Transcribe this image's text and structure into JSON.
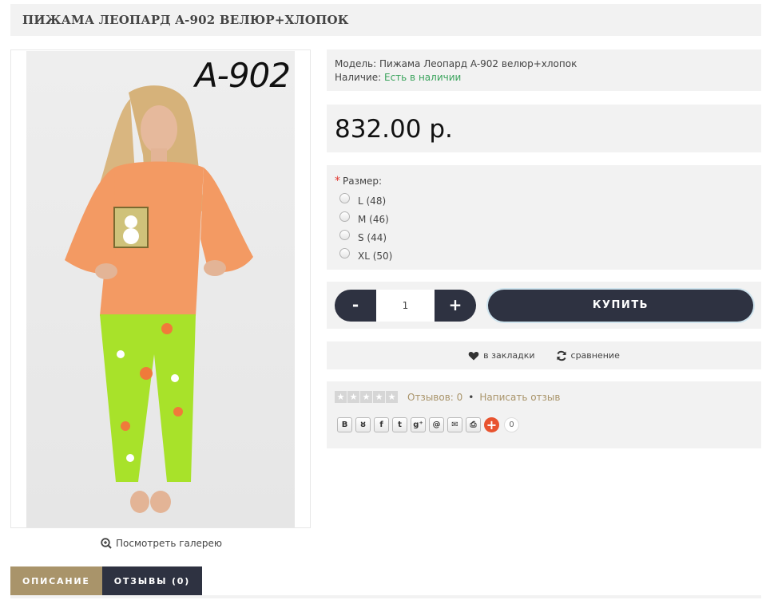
{
  "product": {
    "title": "ПИЖАМА ЛЕОПАРД A-902 ВЕЛЮР+ХЛОПОК",
    "image_label": "A-902",
    "gallery_link": "Посмотреть галерею"
  },
  "info": {
    "model_label": "Модель:",
    "model_value": "Пижама Леопард A-902 велюр+хлопок",
    "availability_label": "Наличие:",
    "availability_value": "Есть в наличии",
    "availability_color": "#3aa35c"
  },
  "price": "832.00 р.",
  "size": {
    "label": "Размер:",
    "options": [
      "L (48)",
      "M (46)",
      "S (44)",
      "XL (50)"
    ]
  },
  "cart": {
    "minus": "-",
    "quantity": "1",
    "plus": "+",
    "buy_label": "КУПИТЬ"
  },
  "actions": {
    "bookmarks": "в закладки",
    "compare": "сравнение"
  },
  "reviews": {
    "rating": 0,
    "count_label": "Отзывов: 0",
    "separator": "•",
    "write_label": "Написать отзыв"
  },
  "share": {
    "buttons": [
      {
        "icon": "vk-icon",
        "glyph": "В"
      },
      {
        "icon": "odnoklassniki-icon",
        "glyph": "ȣ"
      },
      {
        "icon": "facebook-icon",
        "glyph": "f"
      },
      {
        "icon": "twitter-icon",
        "glyph": "t"
      },
      {
        "icon": "google-plus-icon",
        "glyph": "g⁺"
      },
      {
        "icon": "mail-ru-icon",
        "glyph": "@"
      },
      {
        "icon": "email-icon",
        "glyph": "✉"
      },
      {
        "icon": "print-icon",
        "glyph": "⎙"
      }
    ],
    "plus": "+",
    "count": "0"
  },
  "tabs": [
    {
      "label": "ОПИСАНИЕ",
      "active": true
    },
    {
      "label": "ОТЗЫВЫ (0)",
      "active": false
    }
  ],
  "colors": {
    "accent": "#a9946a",
    "dark": "#2e3241",
    "panel": "#f2f2f2"
  }
}
